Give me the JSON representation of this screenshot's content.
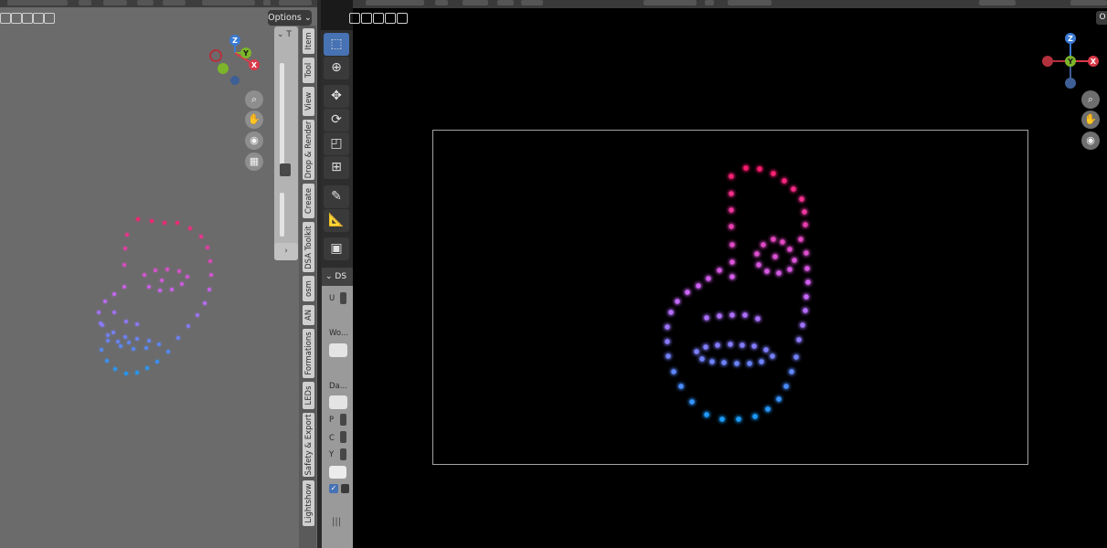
{
  "left_viewport": {
    "options_label": "Options",
    "npanel_header": "T",
    "tabs": [
      "Item",
      "Tool",
      "View",
      "Drop & Render",
      "Create",
      "DSA Toolkit",
      "osm",
      "AN",
      "Formations",
      "LEDs",
      "Safety & Export",
      "Lightshow"
    ],
    "gizmo": {
      "z": "Z",
      "y": "Y",
      "x": "X"
    }
  },
  "toolbar": {
    "tools": [
      "select-box",
      "cursor",
      "move",
      "rotate",
      "scale",
      "transform",
      "annotate",
      "measure",
      "add-cube"
    ]
  },
  "ds_panel": {
    "header": "DS",
    "labels": [
      "U",
      "Wo...",
      "Da...",
      "P",
      "C",
      "Y"
    ]
  },
  "right_viewport": {
    "corner_label": "O",
    "gizmo": {
      "z": "Z",
      "y": "Y",
      "x": "X"
    }
  },
  "colors": {
    "top": "#ff1f6e",
    "mid": "#cc66ff",
    "bottom": "#1a9cff",
    "left_viewport_bg": "#6b6b6b",
    "right_viewport_bg": "#000000"
  }
}
